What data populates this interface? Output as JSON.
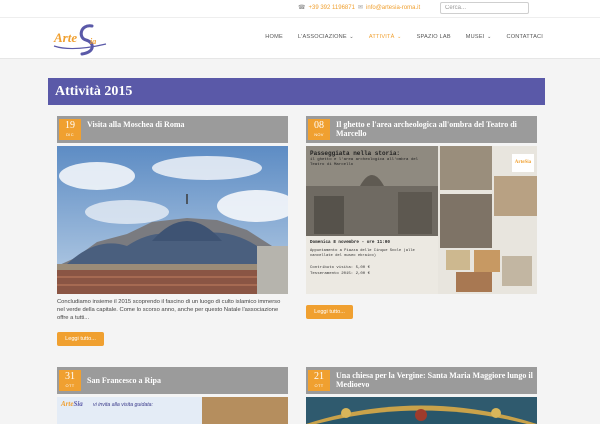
{
  "topbar": {
    "phone": "+39 392 1196871",
    "email": "info@artesia-roma.it",
    "search_placeholder": "Cerca..."
  },
  "logo": {
    "text": "Arte",
    "accent": "Sia"
  },
  "nav": [
    {
      "label": "HOME",
      "active": false,
      "dropdown": false
    },
    {
      "label": "L'ASSOCIAZIONE",
      "active": false,
      "dropdown": true
    },
    {
      "label": "ATTIVITÀ",
      "active": true,
      "dropdown": true
    },
    {
      "label": "SPAZIO LAB",
      "active": false,
      "dropdown": false
    },
    {
      "label": "MUSEI",
      "active": false,
      "dropdown": true
    },
    {
      "label": "CONTATTACI",
      "active": false,
      "dropdown": false
    }
  ],
  "page_title": "Attività 2015",
  "cards": [
    {
      "day": "19",
      "month": "DIC",
      "title": "Visita alla Moschea di Roma",
      "excerpt": "Concludiamo insieme il 2015 scoprendo il fascino di un luogo di culto islamico immerso nel verde della capitale. Come lo scorso anno, anche per questo Natale l'associazione offre a tutti...",
      "button": "Leggi tutto..."
    },
    {
      "day": "08",
      "month": "NOV",
      "title": "Il ghetto e l'area archeologica all'ombra del Teatro di Marcello",
      "poster_title": "Passeggiata nella storia:",
      "poster_sub": "il ghetto e l'area archeologica all'ombra del Teatro di Marcello",
      "poster_date": "Domenica 8 novembre - ore 11:00",
      "poster_meet": "Appuntamento a Piazza delle Cinque Scole (alle cancellate del museo ebraico)",
      "poster_price": "Contributo visita: 5,00 €",
      "poster_price2": "Tesseramento 2015: 2,00 €",
      "button": "Leggi tutto..."
    },
    {
      "day": "31",
      "month": "OTT",
      "title": "San Francesco a Ripa",
      "poster_caption": "vi invita alla visita guidata:"
    },
    {
      "day": "21",
      "month": "OTT",
      "title": "Una chiesa per la Vergine: Santa Maria Maggiore lungo il Medioevo"
    }
  ],
  "colors": {
    "accent": "#f0a030",
    "title_bar": "#5a59a8",
    "card_header": "#9b9b9b"
  }
}
